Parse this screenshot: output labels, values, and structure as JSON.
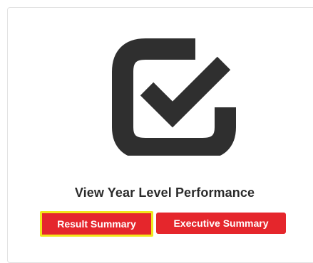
{
  "card": {
    "icon": "checkbox-check-icon",
    "title": "View Year Level Performance",
    "buttons": {
      "result_summary": "Result Summary",
      "executive_summary": "Executive Summary"
    }
  },
  "colors": {
    "icon": "#2f2f2f",
    "button_bg": "#e5262c",
    "button_text": "#ffffff",
    "highlight": "#f1e61b",
    "title_text": "#2b2b2b"
  }
}
